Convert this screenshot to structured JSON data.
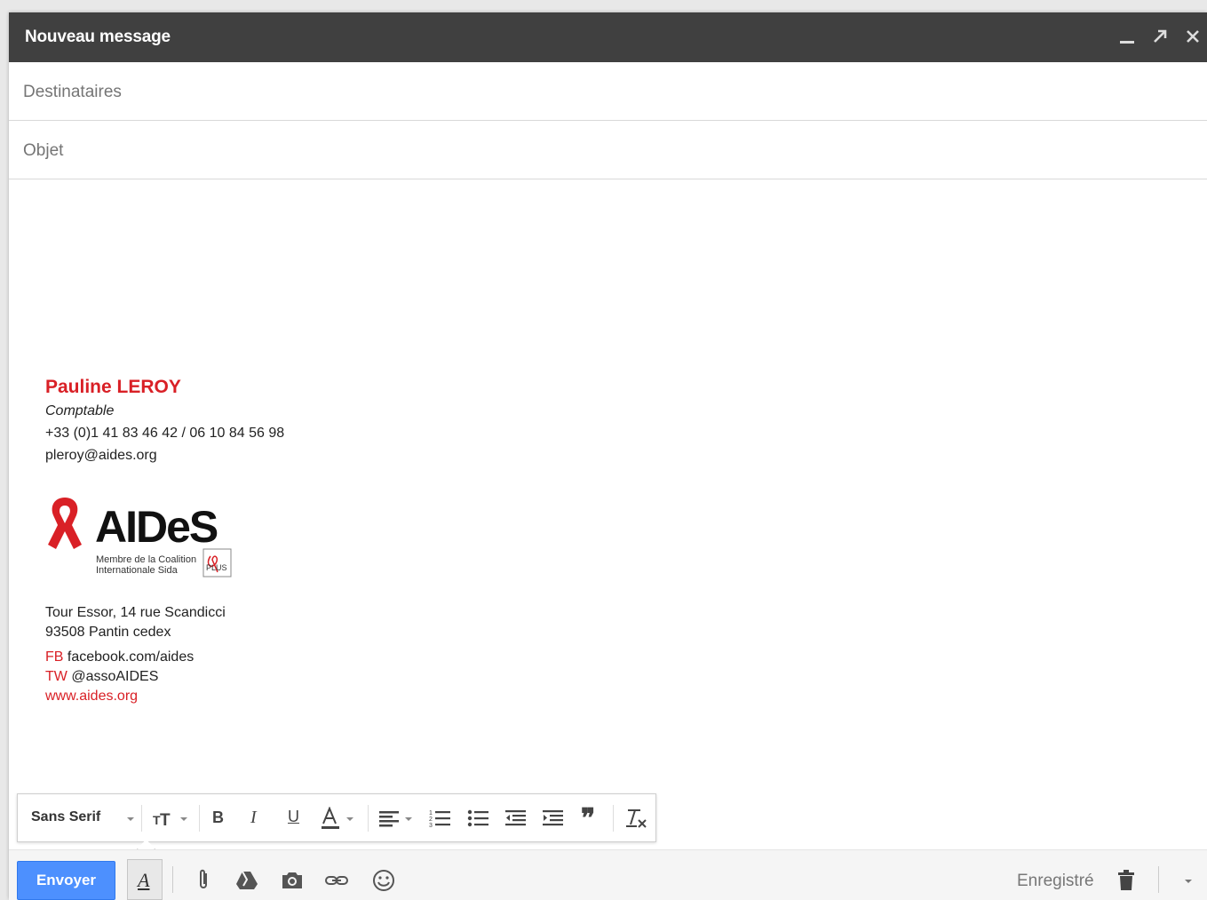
{
  "window": {
    "title": "Nouveau message"
  },
  "fields": {
    "to_placeholder": "Destinataires",
    "subject_placeholder": "Objet"
  },
  "signature": {
    "name": "Pauline LEROY",
    "job": "Comptable",
    "phone": "+33 (0)1 41 83 46 42 / 06 10 84 56 98",
    "email": "pleroy@aides.org",
    "logo_text": "AIDeS",
    "coalition_line1": "Membre de la Coalition",
    "coalition_line2": "Internationale Sida",
    "plus_text": "PLUS",
    "address_line1": "Tour Essor, 14 rue Scandicci",
    "address_line2": "93508 Pantin cedex",
    "fb_label": "FB",
    "fb_value": "facebook.com/aides",
    "tw_label": "TW",
    "tw_value": "@assoAIDES",
    "website": "www.aides.org"
  },
  "format_toolbar": {
    "font": "Sans Serif",
    "bold_label": "B",
    "italic_label": "I",
    "underline_label": "U",
    "quote_label": "❞"
  },
  "bottom_bar": {
    "send_label": "Envoyer",
    "format_toggle_label": "A",
    "saved_label": "Enregistré"
  },
  "colors": {
    "titlebar": "#404040",
    "brand_red": "#d92026",
    "send_blue": "#4d90fe"
  }
}
